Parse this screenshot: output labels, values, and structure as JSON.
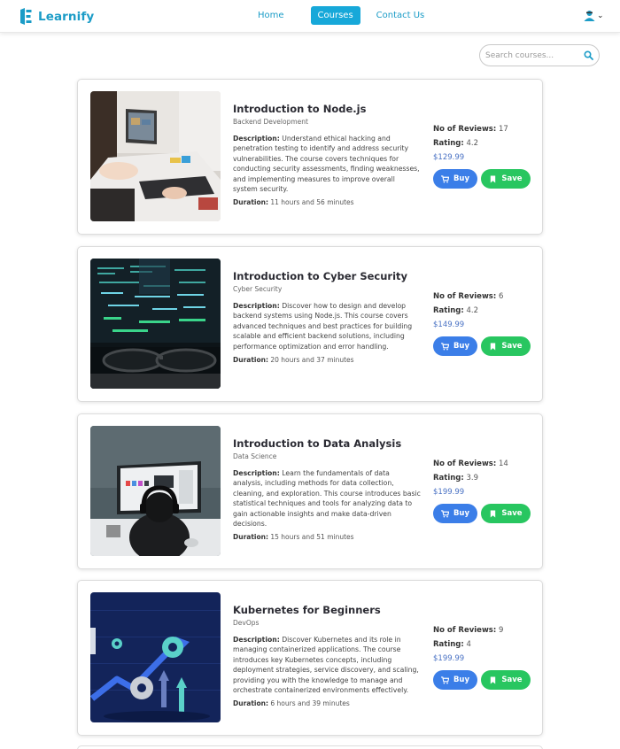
{
  "brand": {
    "name": "Learnify"
  },
  "nav": {
    "home": "Home",
    "courses": "Courses",
    "contact": "Contact Us"
  },
  "search": {
    "placeholder": "Search courses..."
  },
  "labels": {
    "description": "Description:",
    "duration": "Duration:",
    "reviews": "No of Reviews:",
    "rating": "Rating:",
    "buy": "Buy",
    "save": "Save"
  },
  "courses": [
    {
      "title": "Introduction to Node.js",
      "category": "Backend Development",
      "description": "Understand ethical hacking and penetration testing to identify and address security vulnerabilities. The course covers techniques for conducting security assessments, finding weaknesses, and implementing measures to improve overall system security.",
      "duration": "11 hours and 56 minutes",
      "reviews": "17",
      "rating": "4.2",
      "price": "$129.99",
      "image_icon": "laptop-desk-photo"
    },
    {
      "title": "Introduction to Cyber Security",
      "category": "Cyber Security",
      "description": "Discover how to design and develop backend systems using Node.js. This course covers advanced techniques and best practices for building scalable and efficient backend solutions, including performance optimization and error handling.",
      "duration": "20 hours and 37 minutes",
      "reviews": "6",
      "rating": "4.2",
      "price": "$149.99",
      "image_icon": "code-screen-glasses-photo"
    },
    {
      "title": "Introduction to Data Analysis",
      "category": "Data Science",
      "description": "Learn the fundamentals of data analysis, including methods for data collection, cleaning, and exploration. This course introduces basic statistical techniques and tools for analyzing data to gain actionable insights and make data-driven decisions.",
      "duration": "15 hours and 51 minutes",
      "reviews": "14",
      "rating": "3.9",
      "price": "$199.99",
      "image_icon": "person-headphones-monitor-photo"
    },
    {
      "title": "Kubernetes for Beginners",
      "category": "DevOps",
      "description": "Discover Kubernetes and its role in managing containerized applications. The course introduces key Kubernetes concepts, including deployment strategies, service discovery, and scaling, providing you with the knowledge to manage and orchestrate containerized environments effectively.",
      "duration": "6 hours and 39 minutes",
      "reviews": "9",
      "rating": "4",
      "price": "$199.99",
      "image_icon": "gears-growth-arrow-illustration"
    }
  ],
  "colors": {
    "brand": "#1b9cc7",
    "nav_active": "#17a8d9",
    "buy": "#3b7ee8",
    "save": "#28c660",
    "price": "#4a72c4"
  }
}
